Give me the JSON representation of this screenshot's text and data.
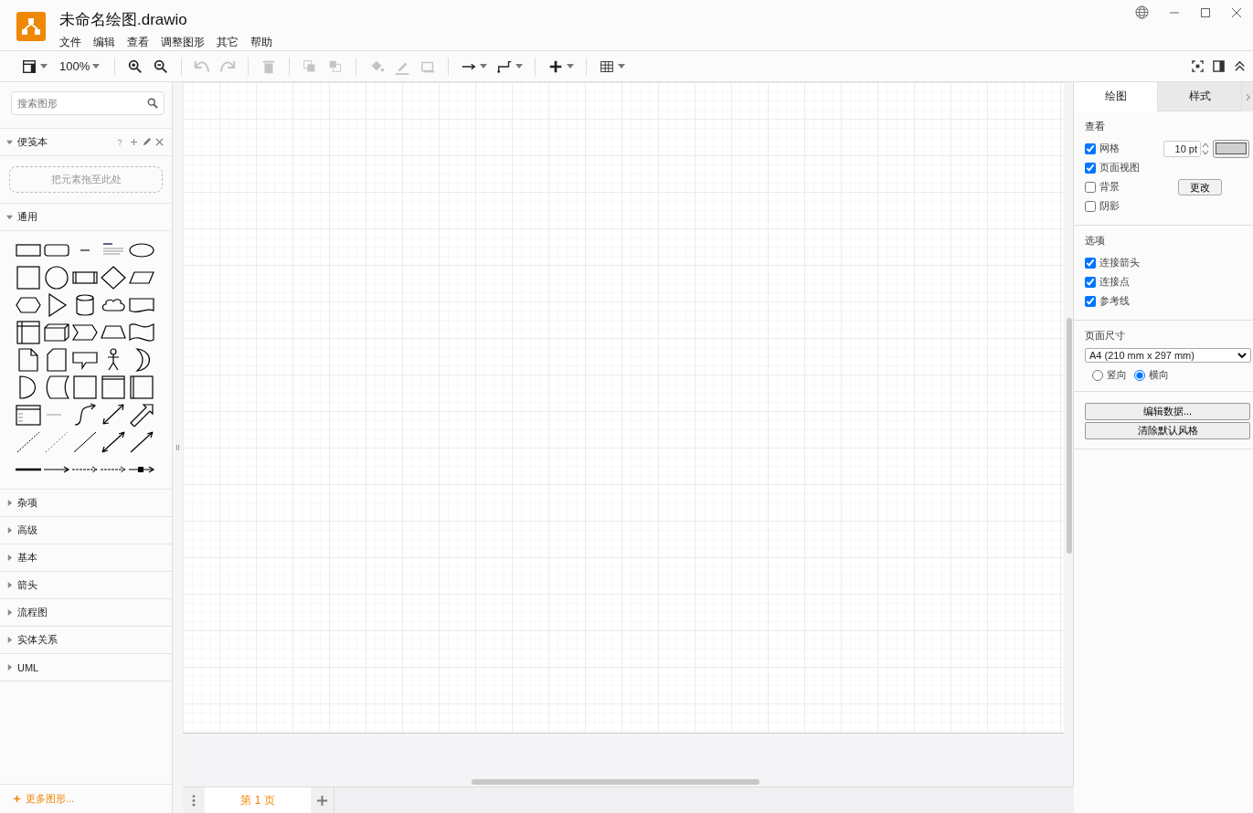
{
  "window": {
    "title": "未命名绘图.drawio"
  },
  "menu": [
    "文件",
    "编辑",
    "查看",
    "调整图形",
    "其它",
    "帮助"
  ],
  "toolbar": [
    {
      "kind": "layout",
      "disabled": false
    },
    {
      "kind": "zoom",
      "label": "100%",
      "disabled": false
    },
    {
      "kind": "sep"
    },
    {
      "kind": "zoom-in",
      "disabled": false
    },
    {
      "kind": "zoom-out",
      "disabled": false
    },
    {
      "kind": "sep"
    },
    {
      "kind": "undo",
      "disabled": true
    },
    {
      "kind": "redo",
      "disabled": true
    },
    {
      "kind": "sep"
    },
    {
      "kind": "delete",
      "disabled": true
    },
    {
      "kind": "sep"
    },
    {
      "kind": "to-front",
      "disabled": true
    },
    {
      "kind": "to-back",
      "disabled": true
    },
    {
      "kind": "sep"
    },
    {
      "kind": "fill",
      "disabled": true
    },
    {
      "kind": "line",
      "disabled": true
    },
    {
      "kind": "shadow",
      "disabled": true
    },
    {
      "kind": "sep"
    },
    {
      "kind": "connection",
      "disabled": false
    },
    {
      "kind": "waypoint",
      "disabled": false
    },
    {
      "kind": "sep"
    },
    {
      "kind": "insert",
      "disabled": false
    },
    {
      "kind": "sep"
    },
    {
      "kind": "table",
      "disabled": false
    }
  ],
  "sidebar": {
    "search": {
      "placeholder": "搜索图形"
    },
    "scratchpad": {
      "title": "便笺本",
      "expanded": true,
      "drop_hint": "把元素拖至此处"
    },
    "general": {
      "title": "通用",
      "expanded": true
    },
    "sections": [
      {
        "title": "杂项",
        "expanded": false
      },
      {
        "title": "高级",
        "expanded": false
      },
      {
        "title": "基本",
        "expanded": false
      },
      {
        "title": "箭头",
        "expanded": false
      },
      {
        "title": "流程图",
        "expanded": false
      },
      {
        "title": "实体关系",
        "expanded": false
      },
      {
        "title": "UML",
        "expanded": false
      }
    ],
    "more": "更多图形..."
  },
  "format_panel": {
    "tabs": [
      {
        "label": "绘图",
        "selected": true
      },
      {
        "label": "样式",
        "selected": false
      }
    ],
    "view": {
      "title": "查看",
      "items": [
        {
          "label": "网格",
          "checked": true
        },
        {
          "label": "页面视图",
          "checked": true
        },
        {
          "label": "背景",
          "checked": false
        },
        {
          "label": "阴影",
          "checked": false
        }
      ],
      "grid_size": "10 pt",
      "change_button": "更改"
    },
    "options": {
      "title": "选项",
      "items": [
        {
          "label": "连接箭头",
          "checked": true
        },
        {
          "label": "连接点",
          "checked": true
        },
        {
          "label": "参考线",
          "checked": true
        }
      ]
    },
    "page_size": {
      "title": "页面尺寸",
      "value": "A4 (210 mm x 297 mm)",
      "orientation": [
        {
          "label": "竖向",
          "selected": false
        },
        {
          "label": "横向",
          "selected": true
        }
      ]
    },
    "buttons": [
      "编辑数据...",
      "清除默认风格"
    ]
  },
  "pages": [
    {
      "label": "第 1 页",
      "selected": true
    }
  ]
}
